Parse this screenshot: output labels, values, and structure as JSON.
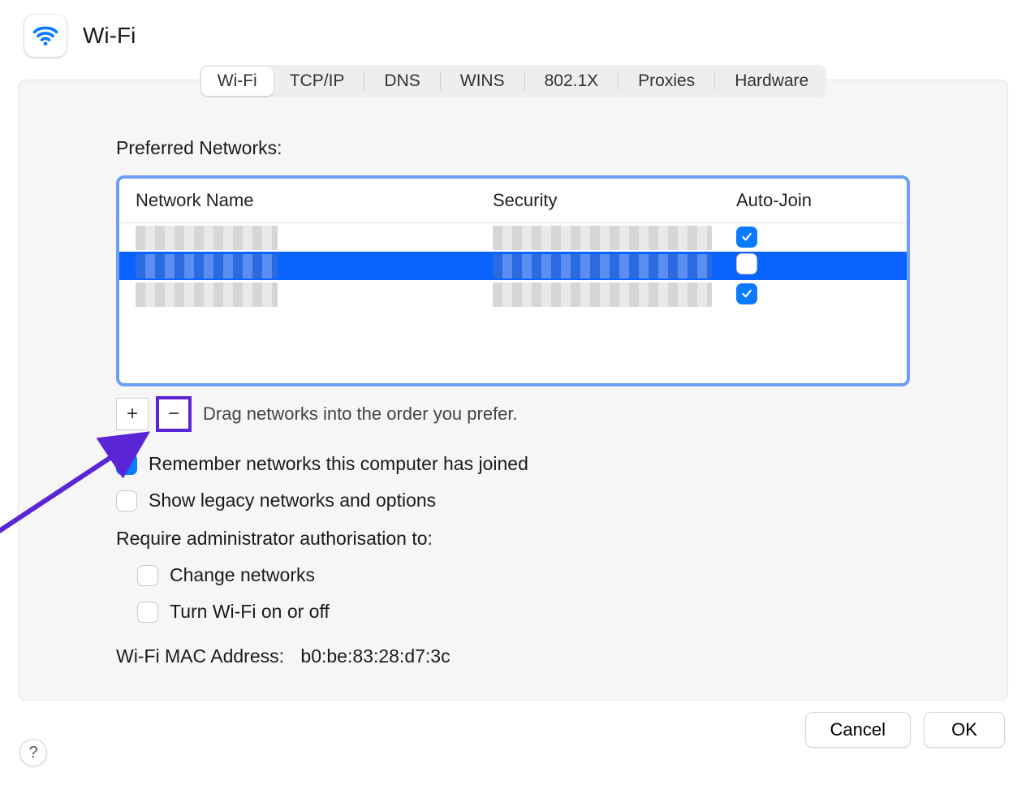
{
  "header": {
    "title": "Wi-Fi"
  },
  "tabs": {
    "items": [
      "Wi-Fi",
      "TCP/IP",
      "DNS",
      "WINS",
      "802.1X",
      "Proxies",
      "Hardware"
    ],
    "active_index": 0
  },
  "preferred_networks": {
    "label": "Preferred Networks:",
    "columns": {
      "name": "Network Name",
      "security": "Security",
      "autojoin": "Auto-Join"
    },
    "rows": [
      {
        "name": "[redacted]",
        "security": "[redacted]",
        "autojoin": true,
        "selected": false
      },
      {
        "name": "[redacted]",
        "security": "[redacted]",
        "autojoin": false,
        "selected": true
      },
      {
        "name": "[redacted]",
        "security": "[redacted]",
        "autojoin": true,
        "selected": false
      }
    ],
    "add_symbol": "+",
    "remove_symbol": "−",
    "hint": "Drag networks into the order you prefer."
  },
  "options": {
    "remember": {
      "label": "Remember networks this computer has joined",
      "checked": true
    },
    "legacy": {
      "label": "Show legacy networks and options",
      "checked": false
    },
    "require_admin_label": "Require administrator authorisation to:",
    "change": {
      "label": "Change networks",
      "checked": false
    },
    "toggle": {
      "label": "Turn Wi-Fi on or off",
      "checked": false
    }
  },
  "mac_address": {
    "label": "Wi-Fi MAC Address:",
    "value": "b0:be:83:28:d7:3c"
  },
  "footer": {
    "cancel": "Cancel",
    "ok": "OK",
    "help": "?"
  }
}
